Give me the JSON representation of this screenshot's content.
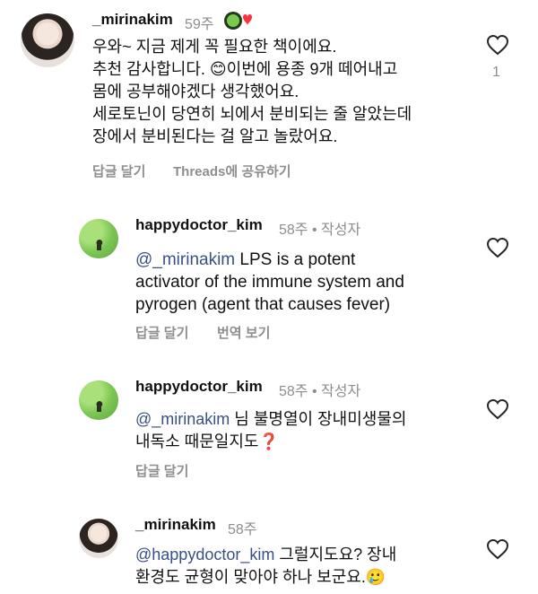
{
  "comments": [
    {
      "author": "_mirinakim",
      "time": "59주",
      "lines": [
        "우와~ 지금 제게 꼭 필요한 책이에요.",
        "추천 감사합니다. 😊이번에 용종 9개 떼어내고",
        "몸에 공부해야겠다 생각했어요.",
        "세로토닌이 당연히 뇌에서 분비되는 줄 알았는데",
        "장에서 분비된다는 걸 알고 놀랐어요."
      ],
      "reply_label": "답글 달기",
      "share_label": "Threads에 공유하기",
      "like_count": "1"
    },
    {
      "author": "happydoctor_kim",
      "time": "58주",
      "author_badge": "작성자",
      "mention": "@_mirinakim",
      "lines": [
        " LPS is a potent",
        "activator of the immune system and",
        "pyrogen (agent that causes fever)"
      ],
      "reply_label": "답글 달기",
      "translate_label": "번역 보기"
    },
    {
      "author": "happydoctor_kim",
      "time": "58주",
      "author_badge": "작성자",
      "mention": "@_mirinakim",
      "lines": [
        " 님 불명열이 장내미생물의",
        "내독소 때문일지도❓"
      ],
      "reply_label": "답글 달기"
    },
    {
      "author": "_mirinakim",
      "time": "58주",
      "mention": "@happydoctor_kim",
      "lines": [
        " 그럴지도요? 장내",
        "환경도 균형이 맞아야 하나 보군요.🥲"
      ]
    }
  ],
  "icons": {
    "heart": "heart-outline-icon",
    "badge": "green-heart-badge-icon"
  },
  "colors": {
    "mention": "#385185",
    "muted": "#8e8e8e",
    "heart_red": "#ff3040"
  }
}
